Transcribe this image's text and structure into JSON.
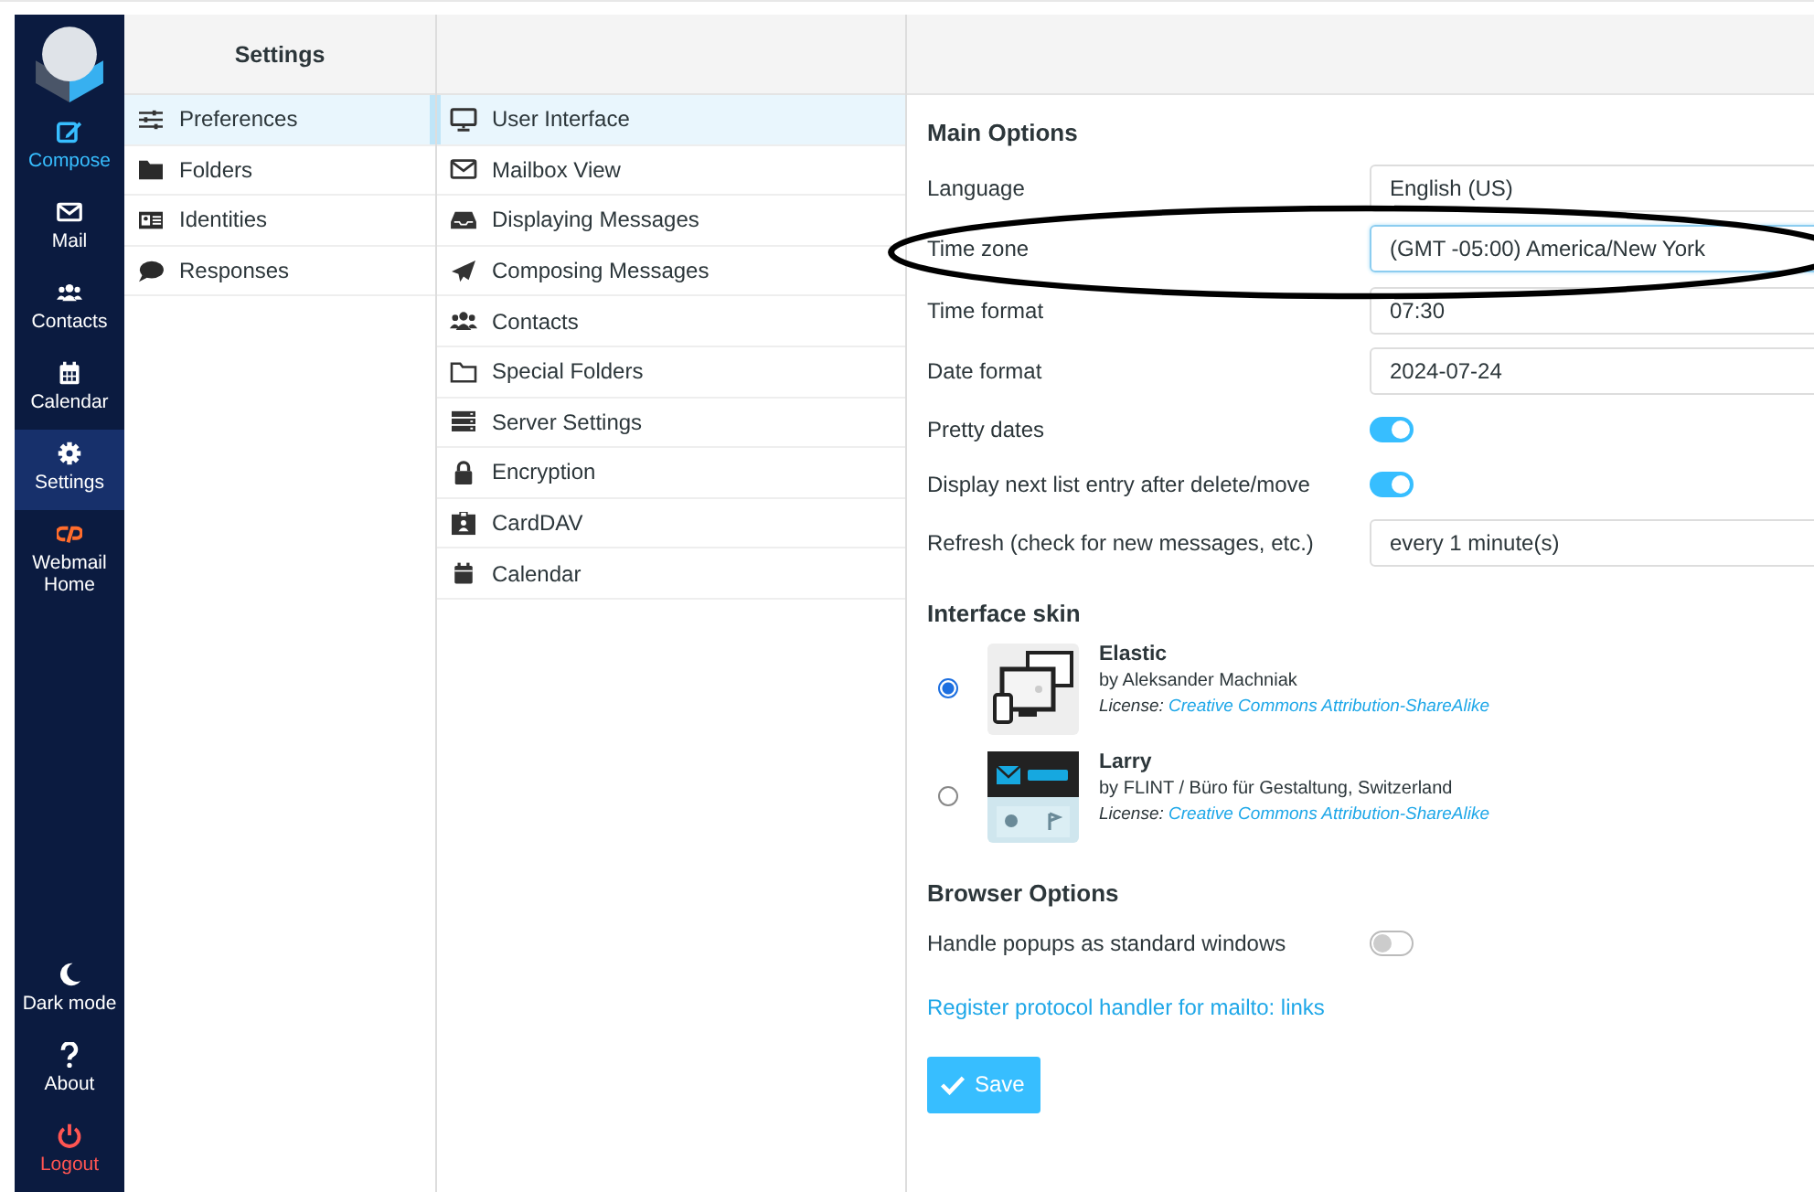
{
  "nav": [
    {
      "kind": "compose",
      "label": "Compose",
      "selected": false
    },
    {
      "kind": "mail",
      "label": "Mail",
      "selected": false
    },
    {
      "kind": "contacts",
      "label": "Contacts",
      "selected": false
    },
    {
      "kind": "calendar",
      "label": "Calendar",
      "selected": false
    },
    {
      "kind": "settings",
      "label": "Settings",
      "selected": true
    },
    {
      "kind": "cpanel",
      "label": "Webmail Home",
      "selected": false
    }
  ],
  "nav_bottom": [
    {
      "kind": "darkmode",
      "label": "Dark mode"
    },
    {
      "kind": "about",
      "label": "About"
    },
    {
      "kind": "logout",
      "label": "Logout"
    }
  ],
  "settings_header": "Settings",
  "sections": [
    {
      "kind": "sliders",
      "label": "Preferences",
      "selected": true
    },
    {
      "kind": "folder",
      "label": "Folders",
      "selected": false
    },
    {
      "kind": "idcard",
      "label": "Identities",
      "selected": false
    },
    {
      "kind": "bubble",
      "label": "Responses",
      "selected": false
    }
  ],
  "subsections": [
    {
      "kind": "monitor",
      "label": "User Interface",
      "selected": true
    },
    {
      "kind": "envelope",
      "label": "Mailbox View",
      "selected": false
    },
    {
      "kind": "inbox",
      "label": "Displaying Messages",
      "selected": false
    },
    {
      "kind": "plane",
      "label": "Composing Messages",
      "selected": false
    },
    {
      "kind": "people",
      "label": "Contacts",
      "selected": false
    },
    {
      "kind": "folder-outline",
      "label": "Special Folders",
      "selected": false
    },
    {
      "kind": "server",
      "label": "Server Settings",
      "selected": false
    },
    {
      "kind": "lock",
      "label": "Encryption",
      "selected": false
    },
    {
      "kind": "badge",
      "label": "CardDAV",
      "selected": false
    },
    {
      "kind": "calendar",
      "label": "Calendar",
      "selected": false
    }
  ],
  "main_options": {
    "title": "Main Options",
    "rows": [
      {
        "kind": "select",
        "label": "Language",
        "value": "English (US)",
        "focused": false
      },
      {
        "kind": "select",
        "label": "Time zone",
        "value": "(GMT -05:00) America/New York",
        "focused": true
      },
      {
        "kind": "select",
        "label": "Time format",
        "value": "07:30",
        "focused": false
      },
      {
        "kind": "select",
        "label": "Date format",
        "value": "2024-07-24",
        "focused": false
      },
      {
        "kind": "toggle",
        "label": "Pretty dates",
        "on": true
      },
      {
        "kind": "toggle",
        "label": "Display next list entry after delete/move",
        "on": true
      },
      {
        "kind": "select",
        "label": "Refresh (check for new messages, etc.)",
        "value": "every 1 minute(s)",
        "focused": false
      }
    ]
  },
  "interface_skin": {
    "title": "Interface skin",
    "skins": [
      {
        "kind": "devices",
        "name": "Elastic",
        "author": "by Aleksander Machniak",
        "license_label": "License:",
        "license_link": "Creative Commons Attribution-ShareAlike",
        "selected": true
      },
      {
        "kind": "classic",
        "name": "Larry",
        "author": "by FLINT / Büro für Gestaltung, Switzerland",
        "license_label": "License:",
        "license_link": "Creative Commons Attribution-ShareAlike",
        "selected": false
      }
    ]
  },
  "browser_options": {
    "title": "Browser Options",
    "rows": [
      {
        "kind": "toggle",
        "label": "Handle popups as standard windows",
        "on": false
      }
    ],
    "link": "Register protocol handler for mailto: links"
  },
  "save_button": "Save",
  "annotation": {
    "kind": "ellipse"
  }
}
